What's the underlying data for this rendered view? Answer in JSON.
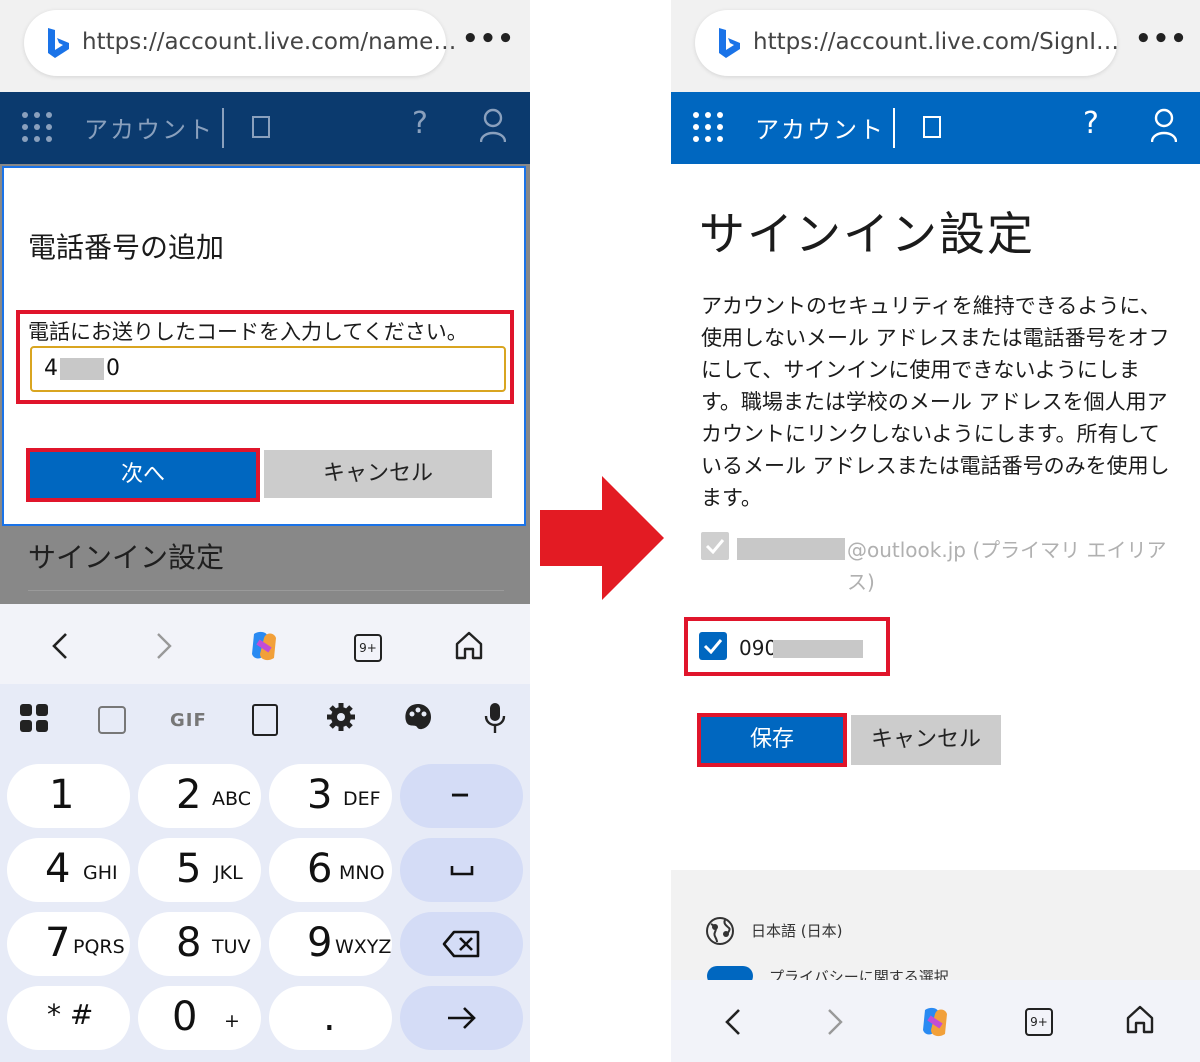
{
  "left": {
    "browser": {
      "url": "https://account.live.com/name…",
      "more": "•••"
    },
    "header": {
      "title": "アカウント",
      "help": "?"
    },
    "dialog": {
      "heading": "電話番号の追加",
      "prompt": "電話にお送りしたコードを入力してください。",
      "code_start": "4",
      "code_end": "0",
      "next_label": "次へ",
      "cancel_label": "キャンセル"
    },
    "behind_title": "サインイン設定",
    "nav": {
      "tabs_count": "9+"
    },
    "keyboard": {
      "toolbar": {
        "gif": "GIF"
      },
      "keys": [
        {
          "num": "1",
          "letters": ""
        },
        {
          "num": "2",
          "letters": "ABC"
        },
        {
          "num": "3",
          "letters": "DEF"
        },
        {
          "num": "4",
          "letters": "GHI"
        },
        {
          "num": "5",
          "letters": "JKL"
        },
        {
          "num": "6",
          "letters": "MNO"
        },
        {
          "num": "7",
          "letters": "PQRS"
        },
        {
          "num": "8",
          "letters": "TUV"
        },
        {
          "num": "9",
          "letters": "WXYZ"
        },
        {
          "num": "* #",
          "letters": ""
        },
        {
          "num": "0",
          "letters": "+"
        },
        {
          "num": ".",
          "letters": ""
        }
      ],
      "minus": "–"
    }
  },
  "right": {
    "browser": {
      "url": "https://account.live.com/SignI…",
      "more": "•••"
    },
    "header": {
      "title": "アカウント",
      "help": "?"
    },
    "page_title": "サインイン設定",
    "description": "アカウントのセキュリティを維持できるように、使用しないメール アドレスまたは電話番号をオフにして、サインインに使用できないようにします。職場または学校のメール アドレスを個人用アカウントにリンクしないようにします。所有しているメール アドレスまたは電話番号のみを使用します。",
    "alias_email": "@outlook.jp (プライマリ エイリアス)",
    "alias_phone": "090",
    "save_label": "保存",
    "cancel_label": "キャンセル",
    "footer": {
      "language": "日本語 (日本)",
      "privacy": "プライバシーに関する選択"
    },
    "nav": {
      "tabs_count": "9+"
    }
  },
  "colors": {
    "red": "#e0152b",
    "ms_blue": "#0067c0",
    "dark_header": "#0b3a6e"
  }
}
